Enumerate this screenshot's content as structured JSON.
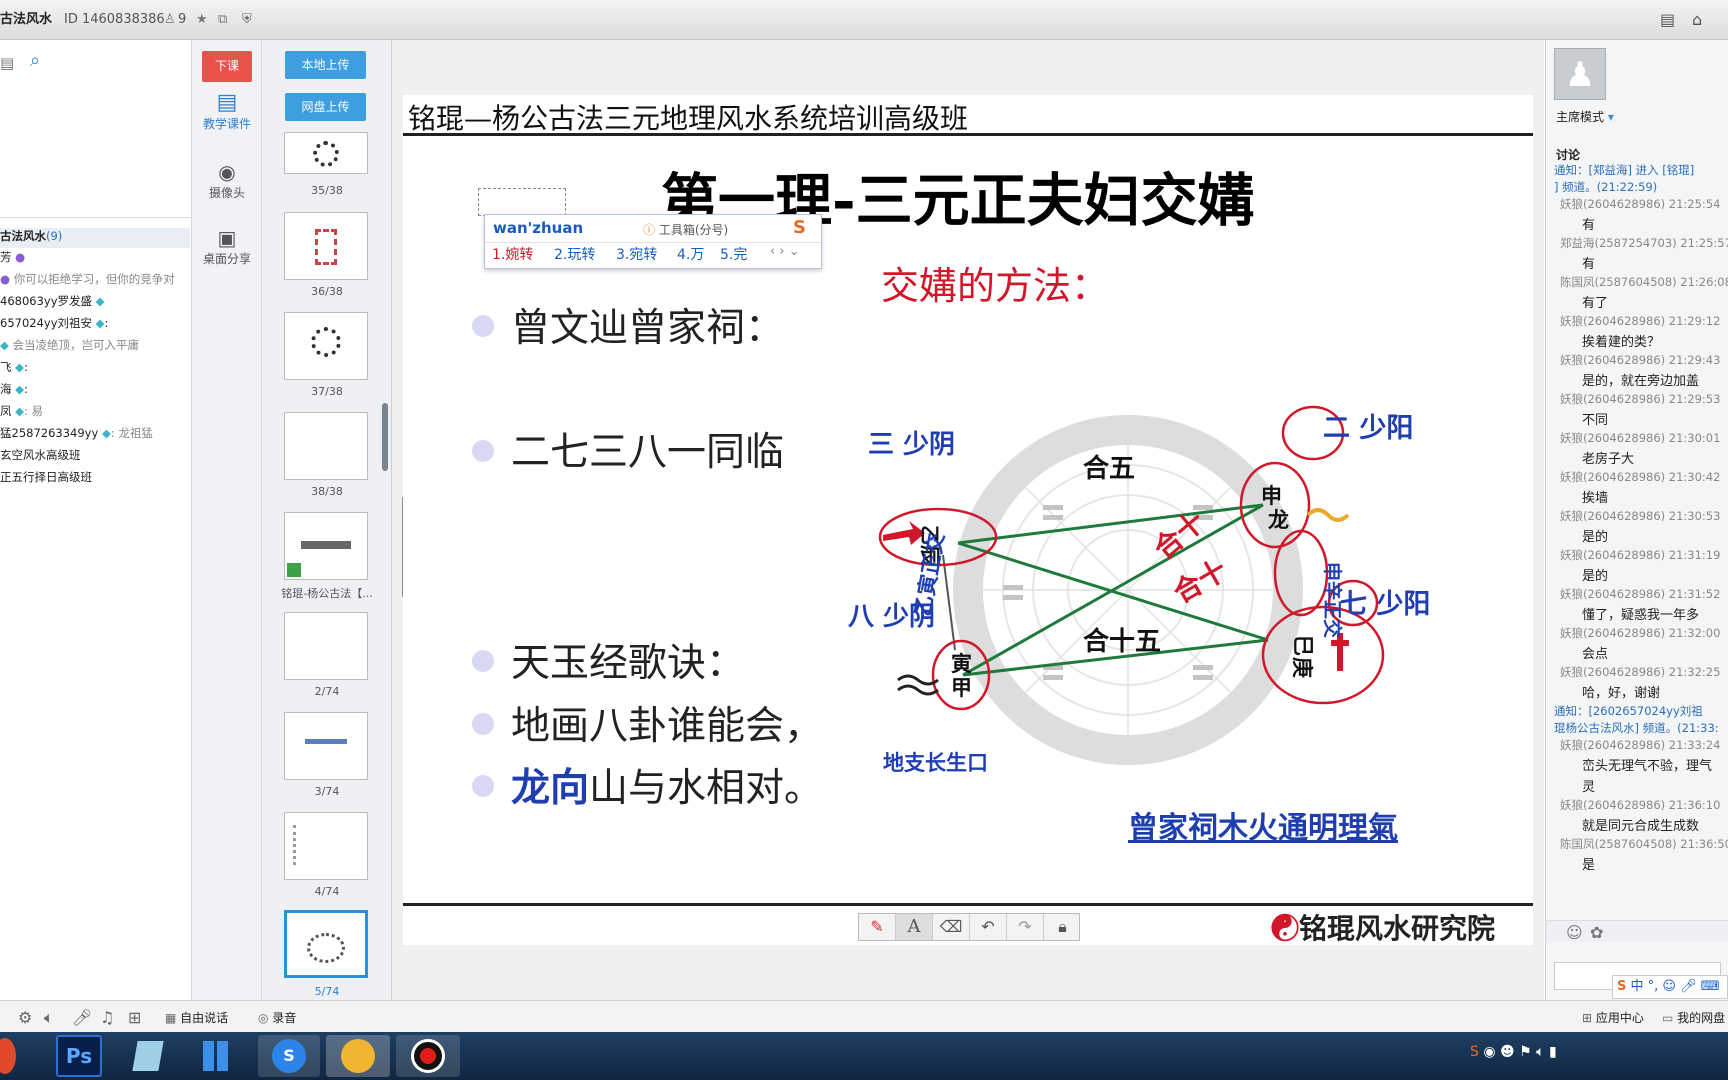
{
  "titlebar": {
    "title": "古法风水",
    "id_label": "ID 1460838386",
    "user_count": "9"
  },
  "left_panel": {
    "members": [
      {
        "name": "古法风水",
        "count": "(9)"
      },
      {
        "name": "芳",
        "note": ""
      },
      {
        "name": "",
        "note": "你可以拒绝学习，但你的竞争对"
      },
      {
        "name": "468063yy罗发盛",
        "note": ""
      },
      {
        "name": "657024yy刘祖安",
        "note": ":"
      },
      {
        "name": "",
        "note": "会当凌绝顶，岂可入平庸"
      },
      {
        "name": "飞",
        "note": ":"
      },
      {
        "name": "海",
        "note": ":"
      },
      {
        "name": "凤",
        "note": ": 易"
      },
      {
        "name": "猛2587263349yy",
        "note": ": 龙祖猛"
      },
      {
        "name": "玄空风水高级班",
        "note": ""
      },
      {
        "name": "正五行择日高级班",
        "note": ""
      }
    ]
  },
  "tool_column": {
    "end_class": "下课",
    "courseware": "教学课件",
    "camera": "摄像头",
    "desktop_share": "桌面分享"
  },
  "thumb_column": {
    "upload_local": "本地上传",
    "upload_cloud": "网盘上传",
    "labels": [
      "35/38",
      "36/38",
      "37/38",
      "38/38",
      "铭琨-杨公古法【...",
      "2/74",
      "3/74",
      "4/74",
      "5/74"
    ]
  },
  "slide": {
    "header": "铭琨—杨公古法三元地理风水系统培训高级班",
    "title": "第一理-三元正夫妇交媾",
    "method": "交媾的方法：",
    "bullets": [
      "曾文辿曾家祠：",
      "二七三八一同临",
      "天玉经歌诀：",
      "地画八卦谁能会，",
      "龙向",
      "山与水相对。"
    ],
    "diagram": {
      "san_shaoyin": "三 少阴",
      "er_shaoyang": "二 少阳",
      "ba_shaoyin": "八 少阴",
      "qi_shaoyang": "七 少阳",
      "he5": "合五",
      "he15": "合十五",
      "he10a": "合十",
      "he10b": "合十",
      "yi_chen": "乙辰",
      "yin": "寅",
      "jia": "甲",
      "shen": "申",
      "long": "龙",
      "si": "巳",
      "geng": "庚",
      "yi_zheng_jiao": "乙寅正交",
      "shen_zheng_jiao": "申辛正交",
      "dizhi": "地支长生口",
      "caption": "曾家祠木火通明理氣"
    },
    "footer": "铭琨风水研究院"
  },
  "ime": {
    "input": "wan'zhuan",
    "toolbox": "工具箱(分号)",
    "candidates": [
      "1.婉转",
      "2.玩转",
      "3.宛转",
      "4.万",
      "5.完"
    ]
  },
  "right_panel": {
    "mode": "主席模式",
    "discussion": "讨论",
    "messages": [
      {
        "type": "notice",
        "text": "通知：[郑益海] 进入 [铭琨]"
      },
      {
        "type": "notice",
        "text": "] 频道。(21:22:59)"
      },
      {
        "type": "name",
        "text": "妖狼(2604628986) 21:25:54"
      },
      {
        "type": "text",
        "text": "有"
      },
      {
        "type": "name",
        "text": "郑益海(2587254703) 21:25:57"
      },
      {
        "type": "text",
        "text": "有"
      },
      {
        "type": "name",
        "text": "陈国凤(2587604508) 21:26:08"
      },
      {
        "type": "text",
        "text": "有了"
      },
      {
        "type": "name",
        "text": "妖狼(2604628986) 21:29:12"
      },
      {
        "type": "text",
        "text": "挨着建的类？"
      },
      {
        "type": "name",
        "text": "妖狼(2604628986) 21:29:43"
      },
      {
        "type": "text",
        "text": "是的，就在旁边加盖"
      },
      {
        "type": "name",
        "text": "妖狼(2604628986) 21:29:53"
      },
      {
        "type": "text",
        "text": "不同"
      },
      {
        "type": "name",
        "text": "妖狼(2604628986) 21:30:01"
      },
      {
        "type": "text",
        "text": "老房子大"
      },
      {
        "type": "name",
        "text": "妖狼(2604628986) 21:30:42"
      },
      {
        "type": "text",
        "text": "挨墙"
      },
      {
        "type": "name",
        "text": "妖狼(2604628986) 21:30:53"
      },
      {
        "type": "text",
        "text": "是的"
      },
      {
        "type": "name",
        "text": "妖狼(2604628986) 21:31:19"
      },
      {
        "type": "text",
        "text": "是的"
      },
      {
        "type": "name",
        "text": "妖狼(2604628986) 21:31:52"
      },
      {
        "type": "text",
        "text": "懂了，疑惑我一年多"
      },
      {
        "type": "name",
        "text": "妖狼(2604628986) 21:32:00"
      },
      {
        "type": "text",
        "text": "会点"
      },
      {
        "type": "name",
        "text": "妖狼(2604628986) 21:32:25"
      },
      {
        "type": "text",
        "text": "哈，好，谢谢"
      },
      {
        "type": "notice",
        "text": "通知：[2602657024yy刘祖"
      },
      {
        "type": "notice",
        "text": "琨杨公古法风水] 频道。(21:33:"
      },
      {
        "type": "name",
        "text": "妖狼(2604628986) 21:33:24"
      },
      {
        "type": "text",
        "text": "峦头无理气不验，理气"
      },
      {
        "type": "text",
        "text": "灵"
      },
      {
        "type": "name",
        "text": "妖狼(2604628986) 21:36:10"
      },
      {
        "type": "text",
        "text": "就是同元合成生成数"
      },
      {
        "type": "name",
        "text": "陈国凤(2587604508) 21:36:50"
      },
      {
        "type": "text",
        "text": "是"
      }
    ],
    "app_center": "应用中心",
    "my_cloud": "我的网盘"
  },
  "bottom_bar": {
    "free_talk": "自由说话",
    "record": "录音"
  },
  "colors": {
    "accent_blue": "#3d9ee0",
    "end_red": "#e8524a",
    "slide_blue": "#1f3fb0",
    "slide_red": "#d0182a",
    "diagram_green": "#1e7a3a",
    "thumb_select": "#2f8fd6"
  }
}
